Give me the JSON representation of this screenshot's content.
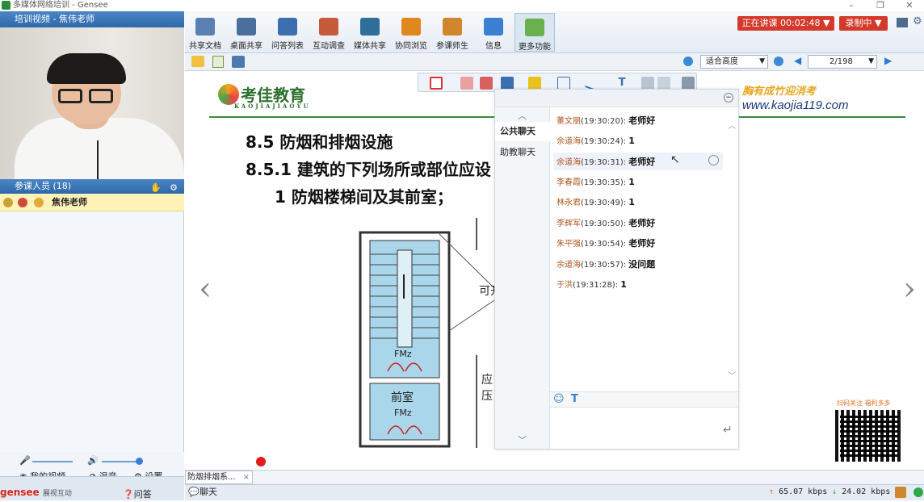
{
  "window": {
    "title": "多媒体网络培训 - Gensee",
    "controls": [
      "–",
      "❐",
      "✕"
    ]
  },
  "left": {
    "video_header": "培训视频 - 焦伟老师",
    "members_header": "参课人员 (18)",
    "member": "焦伟老师",
    "my_video": "我的视频",
    "mix": "混音",
    "settings": "设置",
    "brand": "gensee",
    "brand_sub": "展视互动",
    "qa": "问答"
  },
  "toolbar": {
    "buttons": [
      {
        "label": "共享文档",
        "color": "#5a7fb3"
      },
      {
        "label": "桌面共享",
        "color": "#4a6f9a"
      },
      {
        "label": "问答列表",
        "color": "#3d6fb0"
      },
      {
        "label": "互动调查",
        "color": "#c85a3c"
      },
      {
        "label": "媒体共享",
        "color": "#2f6f9a"
      },
      {
        "label": "协同浏览",
        "color": "#e0881f"
      },
      {
        "label": "参课师生",
        "color": "#d0862a"
      },
      {
        "label": "信息",
        "color": "#3a7fd1"
      },
      {
        "label": "更多功能",
        "color": "#6ab04c"
      }
    ],
    "live": "正在讲课 00:02:48 ▼",
    "record": "录制中 ▼",
    "fit": "适合高度",
    "page": "2/198"
  },
  "slide": {
    "logo": "考佳教育",
    "logo_sub": "KAOJIAJIAOYU",
    "promo": "胸有成竹迎消考",
    "url": "www.kaojia119.com",
    "line1": "8.5 防烟和排烟设施",
    "line2": "8.5.1 建筑的下列场所或部位应设",
    "line3": "1 防烟楼梯间及其前室；",
    "plan_fm1": "FMz",
    "plan_front": "前室",
    "plan_fm2": "FMz",
    "side_text1": "可开",
    "side_text2": "应",
    "side_text3": "压",
    "qr_label": "扫码关注 福利多多",
    "nav_left": "‹",
    "nav_right": "›"
  },
  "chat": {
    "tab_public": "公共聊天",
    "tab_assistant": "助教聊天",
    "messages": [
      {
        "name": "董文朋",
        "time": "(19:30:20):",
        "text": "老师好"
      },
      {
        "name": "余道海",
        "time": "(19:30:24):",
        "text": "1"
      },
      {
        "name": "余道海",
        "time": "(19:30:31):",
        "text": "老师好"
      },
      {
        "name": "李春霞",
        "time": "(19:30:35):",
        "text": "1"
      },
      {
        "name": "林永君",
        "time": "(19:30:49):",
        "text": "1"
      },
      {
        "name": "李辉军",
        "time": "(19:30:50):",
        "text": "老师好"
      },
      {
        "name": "朱平强",
        "time": "(19:30:54):",
        "text": "老师好"
      },
      {
        "name": "余道海",
        "time": "(19:30:57):",
        "text": "没问题"
      },
      {
        "name": "于洪",
        "time": "(19:31:28):",
        "text": "1"
      }
    ]
  },
  "bottom": {
    "doc_tab": "防烟排烟系...",
    "chat_button": "聊天",
    "upload": "65.07 kbps",
    "download": "24.02 kbps"
  }
}
